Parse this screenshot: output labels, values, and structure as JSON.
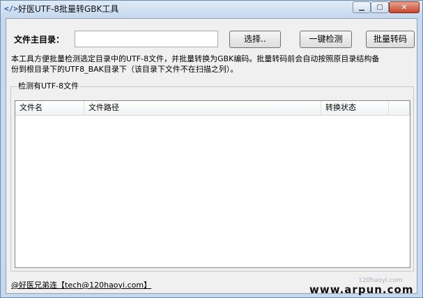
{
  "window": {
    "app_icon": "</>",
    "title": "好医UTF-8批量转GBK工具",
    "min_glyph": "▁",
    "max_glyph": "▢",
    "close_glyph": "✕"
  },
  "form": {
    "dir_label": "文件主目录：",
    "dir_value": "",
    "select_button": "选择..",
    "detect_button": "一键检测",
    "convert_button": "批量转码"
  },
  "description": {
    "line1": "本工具方便批量检测选定目录中的UTF-8文件，并批量转换为GBK编码。批量转码前会自动按照原目录结构备",
    "line2": "份到根目录下的UTF8_BAK目录下（该目录下文件不在扫描之列）。"
  },
  "group": {
    "title": "检测有UTF-8文件",
    "columns": [
      "文件名",
      "文件路径",
      "转换状态",
      ""
    ]
  },
  "footer": {
    "credit": "@好医兄弟连【tech@120haoyi.com】"
  },
  "watermark": {
    "small": "120haoyi.com",
    "main": "www.arpun.com"
  }
}
